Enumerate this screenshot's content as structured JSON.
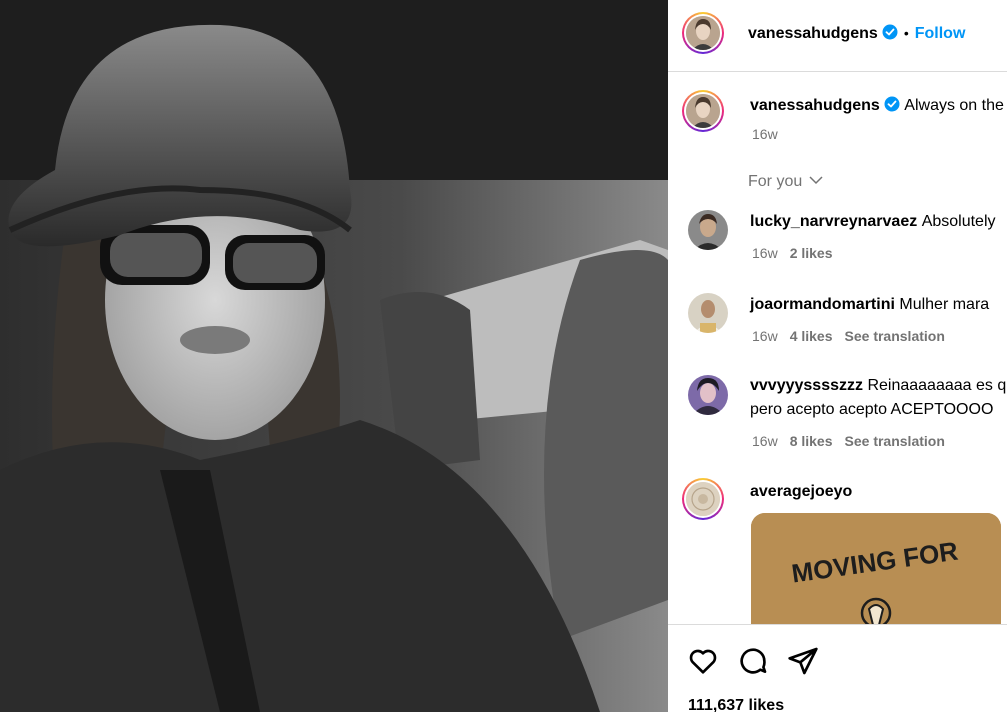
{
  "post": {
    "author": "vanessahudgens",
    "follow_label": "Follow",
    "dot": "•",
    "caption_text": "Always on the",
    "caption_time": "16w",
    "sort_label": "For you",
    "likes_count": "111,637 likes"
  },
  "comments": [
    {
      "user": "lucky_narvreynarvaez",
      "text": "Absolutely",
      "time": "16w",
      "likes": "2 likes",
      "translate": ""
    },
    {
      "user": "joaormandomartini",
      "text": "Mulher mara",
      "time": "16w",
      "likes": "4 likes",
      "translate": "See translation"
    },
    {
      "user": "vvvyyysssszzz",
      "text": "Reinaaaaaaaa es qu",
      "text2": "pero acepto acepto ACEPTOOOO",
      "time": "16w",
      "likes": "8 likes",
      "translate": "See translation"
    },
    {
      "user": "averagejoeyo",
      "text": ""
    }
  ],
  "card_text": "MOVING FOR",
  "colors": {
    "accent": "#0095f6",
    "verified": "#0095f6",
    "muted": "#737373"
  },
  "icons": [
    "heart-icon",
    "comment-icon",
    "share-icon",
    "verified-badge-icon",
    "chevron-down-icon"
  ]
}
